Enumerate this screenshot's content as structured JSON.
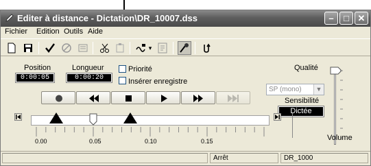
{
  "window": {
    "title": "Editer à distance - Dictation\\DR_10007.dss",
    "controls": [
      "minimize-icon",
      "maximize-icon",
      "close-icon"
    ]
  },
  "menu": [
    "Fichier",
    "Edition",
    "Outils",
    "Aide"
  ],
  "toolbar_icons": [
    "new-document-icon",
    "save-icon",
    "checkmark-icon",
    "cancel-icon",
    "properties-icon",
    "cut-icon",
    "paste-icon",
    "speech-icon",
    "dropdown-arrow-icon",
    "insert-icon",
    "settings-icon",
    "undo-icon"
  ],
  "info": {
    "position_label": "Position",
    "position_value": "0:00:05",
    "longueur_label": "Longueur",
    "longueur_value": "0:00:20",
    "priorite_label": "Priorité",
    "inserer_label": "Insérer enregistre",
    "qualite_label": "Qualité",
    "qualite_value": "SP (mono)",
    "sensibilite_label": "Sensibilité",
    "sensibilite_value": "Dictée",
    "volume_label": "Volume"
  },
  "transport_icons": [
    "record-icon",
    "rewind-icon",
    "stop-icon",
    "play-icon",
    "fast-forward-icon",
    "skip-end-icon"
  ],
  "timeline": {
    "ticks": [
      "0.00",
      "0.05",
      "0.10",
      "0.15"
    ],
    "position_fraction": 0.25
  },
  "status": {
    "state": "Arrêt",
    "author": "DR_1000"
  }
}
